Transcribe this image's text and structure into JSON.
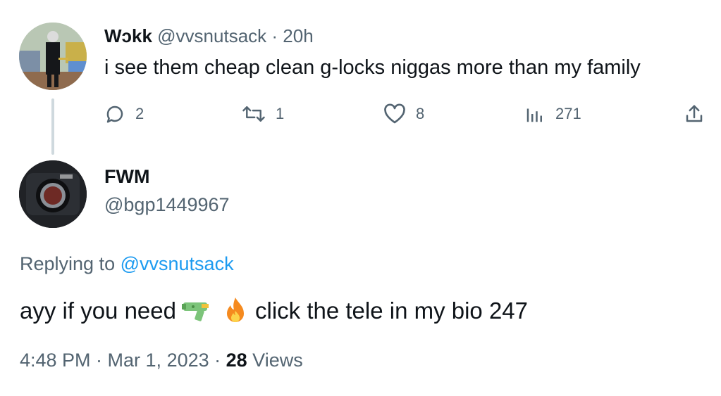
{
  "parent": {
    "display_name": "Wɔkk",
    "handle": "@vvsnutsack",
    "separator": "·",
    "time": "20h",
    "text": "i see them cheap clean g-locks niggas more than my family",
    "actions": {
      "reply_count": "2",
      "retweet_count": "1",
      "like_count": "8",
      "view_count": "271"
    }
  },
  "main": {
    "display_name": "FWM",
    "handle": "@bgp1449967",
    "replying_prefix": "Replying to",
    "replying_mention": "@vvsnutsack",
    "text_before": "ayy if you need",
    "text_after": "click the tele in my bio 247",
    "emojis": [
      "water-pistol",
      "fire"
    ],
    "timestamp": "4:48 PM · Mar 1, 2023 · ",
    "views_count": "28",
    "views_label": " Views"
  },
  "colors": {
    "text_primary": "#0f1419",
    "text_secondary": "#536471",
    "link": "#1d9bf0",
    "thread_line": "#cfd9de"
  }
}
